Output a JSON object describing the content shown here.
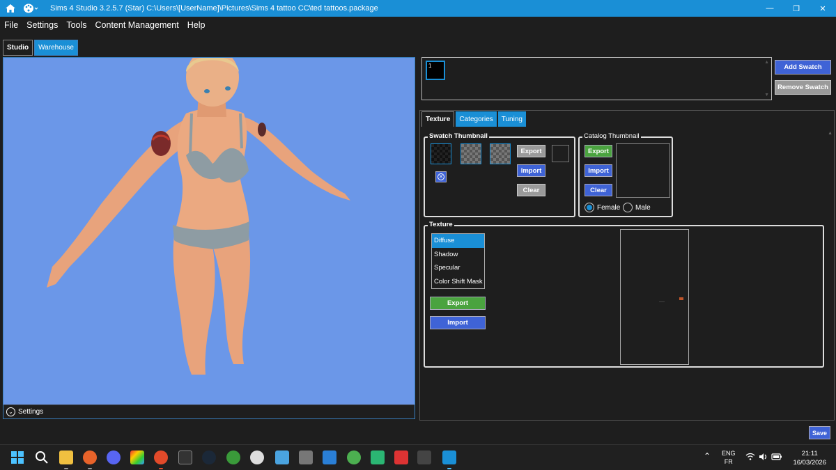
{
  "window": {
    "title": "Sims 4 Studio 3.2.5.7 (Star)  C:\\Users\\[UserName]\\Pictures\\Sims 4 tattoo CC\\ted tattoos.package",
    "minimize": "—",
    "restore": "❐",
    "close": "✕"
  },
  "menu": [
    "File",
    "Settings",
    "Tools",
    "Content Management",
    "Help"
  ],
  "main_tabs": [
    "Studio",
    "Warehouse"
  ],
  "viewport": {
    "settings_label": "Settings"
  },
  "swatches": {
    "items": [
      "1"
    ],
    "add_label": "Add Swatch",
    "remove_label": "Remove Swatch"
  },
  "sub_tabs": [
    "Texture",
    "Categories",
    "Tuning"
  ],
  "swatch_thumbnail": {
    "label": "Swatch Thumbnail",
    "export": "Export",
    "import": "Import",
    "clear": "Clear"
  },
  "catalog_thumbnail": {
    "label": "Catalog Thumbnail",
    "export": "Export",
    "import": "Import",
    "clear": "Clear",
    "female": "Female",
    "male": "Male",
    "selected": "Female"
  },
  "texture": {
    "label": "Texture",
    "items": [
      "Diffuse",
      "Shadow",
      "Specular",
      "Color Shift Mask"
    ],
    "selected": "Diffuse",
    "export": "Export",
    "import": "Import"
  },
  "save_label": "Save",
  "taskbar": {
    "lang_top": "ENG",
    "lang_bottom": "FR",
    "time": "21:11",
    "date": "16/03/2026"
  },
  "colors": {
    "accent": "#1a8fd6",
    "viewport_bg": "#6b97e8",
    "button_blue": "#3f63d6",
    "button_green": "#4aa33f",
    "button_gray": "#9a9a9a"
  }
}
